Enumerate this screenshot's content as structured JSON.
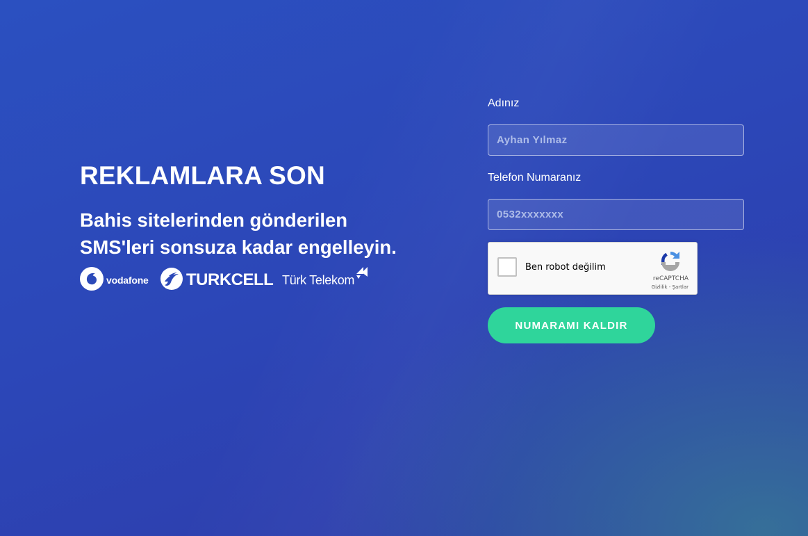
{
  "hero": {
    "title": "REKLAMLARA SON",
    "subtitle_line1": "Bahis sitelerinden gönderilen",
    "subtitle_line2": "SMS'leri sonsuza kadar engelleyin.",
    "logos": {
      "vodafone": "vodafone",
      "turkcell": "TURKCELL",
      "turk_telekom": "Türk Telekom"
    }
  },
  "form": {
    "name_label": "Adınız",
    "name_placeholder": "Ayhan Yılmaz",
    "name_value": "",
    "phone_label": "Telefon Numaranız",
    "phone_placeholder": "0532xxxxxxx",
    "phone_value": "",
    "captcha": {
      "label": "Ben robot değilim",
      "brand": "reCAPTCHA",
      "terms": "Gizlilik - Şartlar",
      "checked": false
    },
    "submit_label": "NUMARAMI KALDIR"
  },
  "colors": {
    "background_top": "#2b50c0",
    "background_bottom": "#2e3aa8",
    "button": "#2fd59b",
    "text": "#ffffff"
  },
  "icons": {
    "vodafone_logo": "vodafone-speechmark-icon",
    "turkcell_logo": "turkcell-leaf-icon",
    "telekom_logo": "turk-telekom-triangles-icon",
    "captcha_logo": "recaptcha-arrows-icon"
  }
}
